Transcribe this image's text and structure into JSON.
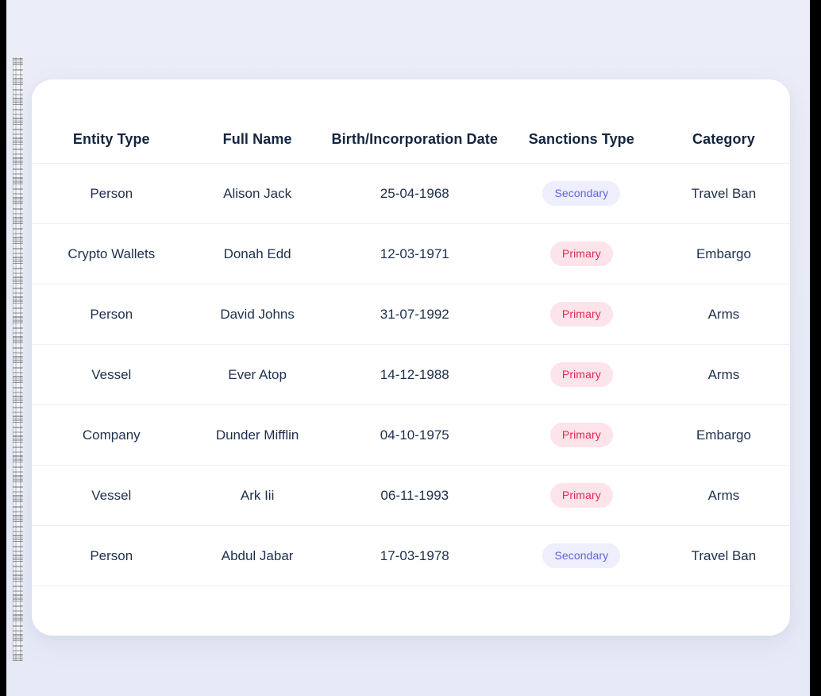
{
  "colors": {
    "page_background": "#E9ECF7",
    "card_background": "#FFFFFF",
    "header_text": "#14253F",
    "cell_text": "#1D2F4D",
    "row_divider": "#EEEFF4",
    "badge_primary_bg": "#FDE3EA",
    "badge_primary_text": "#E02A52",
    "badge_secondary_bg": "#EEEEFC",
    "badge_secondary_text": "#5F63E6"
  },
  "table": {
    "columns": [
      {
        "key": "entity_type",
        "label": "Entity Type"
      },
      {
        "key": "full_name",
        "label": "Full Name"
      },
      {
        "key": "birth_date",
        "label": "Birth/Incorporation Date"
      },
      {
        "key": "sanctions_type",
        "label": "Sanctions Type"
      },
      {
        "key": "category",
        "label": "Category"
      }
    ],
    "rows": [
      {
        "entity_type": "Person",
        "full_name": "Alison Jack",
        "birth_date": "25-04-1968",
        "sanctions_type": "Secondary",
        "sanctions_variant": "secondary",
        "category": "Travel Ban"
      },
      {
        "entity_type": "Crypto Wallets",
        "full_name": "Donah Edd",
        "birth_date": "12-03-1971",
        "sanctions_type": "Primary",
        "sanctions_variant": "primary",
        "category": "Embargo"
      },
      {
        "entity_type": "Person",
        "full_name": "David Johns",
        "birth_date": "31-07-1992",
        "sanctions_type": "Primary",
        "sanctions_variant": "primary",
        "category": "Arms"
      },
      {
        "entity_type": "Vessel",
        "full_name": "Ever Atop",
        "birth_date": "14-12-1988",
        "sanctions_type": "Primary",
        "sanctions_variant": "primary",
        "category": "Arms"
      },
      {
        "entity_type": "Company",
        "full_name": "Dunder Mifflin",
        "birth_date": "04-10-1975",
        "sanctions_type": "Primary",
        "sanctions_variant": "primary",
        "category": "Embargo"
      },
      {
        "entity_type": "Vessel",
        "full_name": "Ark Iii",
        "birth_date": "06-11-1993",
        "sanctions_type": "Primary",
        "sanctions_variant": "primary",
        "category": "Arms"
      },
      {
        "entity_type": "Person",
        "full_name": "Abdul Jabar",
        "birth_date": "17-03-1978",
        "sanctions_type": "Secondary",
        "sanctions_variant": "secondary",
        "category": "Travel Ban"
      }
    ]
  }
}
